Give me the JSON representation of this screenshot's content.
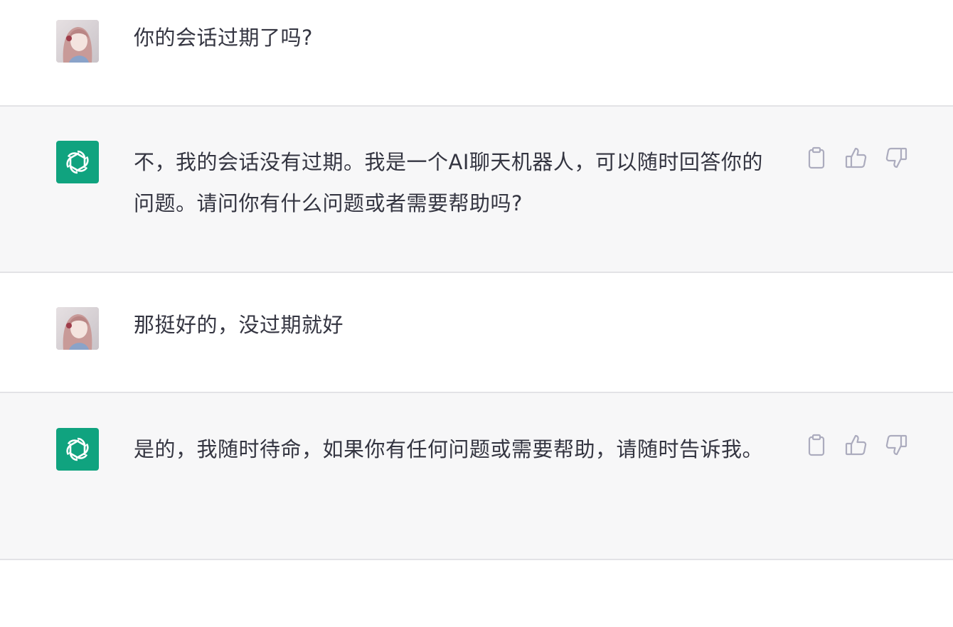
{
  "conversation": {
    "messages": [
      {
        "role": "user",
        "text": "你的会话过期了吗?"
      },
      {
        "role": "assistant",
        "text": "不，我的会话没有过期。我是一个AI聊天机器人，可以随时回答你的问题。请问你有什么问题或者需要帮助吗?"
      },
      {
        "role": "user",
        "text": "那挺好的，没过期就好"
      },
      {
        "role": "assistant",
        "text": "是的，我随时待命，如果你有任何问题或需要帮助，请随时告诉我。"
      }
    ]
  },
  "icons": {
    "user_avatar": "anime-girl-avatar",
    "assistant_avatar": "openai-logo-icon",
    "copy": "clipboard-icon",
    "like": "thumbs-up-icon",
    "dislike": "thumbs-down-icon"
  },
  "colors": {
    "assistant_bg": "#f7f7f8",
    "user_bg": "#ffffff",
    "brand_green": "#10a37f",
    "text": "#343541",
    "icon": "#acacbe",
    "divider": "#e3e3e6"
  }
}
